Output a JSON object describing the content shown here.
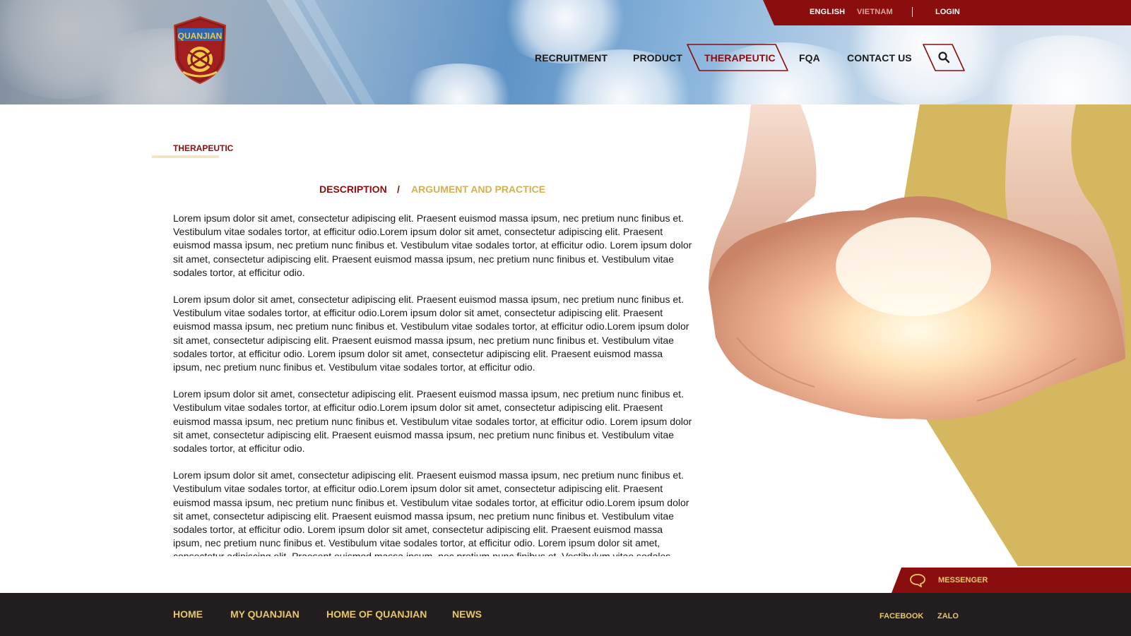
{
  "header": {
    "brand": "QUANJIAN",
    "languages": [
      {
        "label": "ENGLISH",
        "active": true
      },
      {
        "label": "VIETNAM",
        "active": false
      }
    ],
    "login_label": "LOGIN",
    "nav": [
      {
        "label": "RECRUITMENT",
        "active": false
      },
      {
        "label": "PRODUCT",
        "active": false
      },
      {
        "label": "THERAPEUTIC",
        "active": true
      },
      {
        "label": "FQA",
        "active": false
      },
      {
        "label": "CONTACT US",
        "active": false
      }
    ],
    "search_icon": "search-icon"
  },
  "breadcrumb": "THERAPEUTIC",
  "tabs": {
    "description": "DESCRIPTION",
    "separator": "/",
    "argument": "ARGUMENT AND PRACTICE"
  },
  "article": {
    "paragraphs": [
      "Lorem ipsum dolor sit amet, consectetur adipiscing elit. Praesent euismod massa ipsum, nec pretium nunc finibus et. Vestibulum vitae sodales tortor, at efficitur odio.Lorem ipsum dolor sit amet, consectetur adipiscing elit. Praesent euismod massa ipsum, nec pretium nunc finibus et. Vestibulum vitae sodales tortor, at efficitur odio. Lorem ipsum dolor sit amet, consectetur adipiscing elit. Praesent euismod massa ipsum, nec pretium nunc finibus et. Vestibulum vitae sodales tortor, at efficitur odio.",
      "Lorem ipsum dolor sit amet, consectetur adipiscing elit. Praesent euismod massa ipsum, nec pretium nunc finibus et. Vestibulum vitae sodales tortor, at efficitur odio.Lorem ipsum dolor sit amet, consectetur adipiscing elit. Praesent euismod massa ipsum, nec pretium nunc finibus et. Vestibulum vitae sodales tortor, at efficitur odio.Lorem ipsum dolor sit amet, consectetur adipiscing elit. Praesent euismod massa ipsum, nec pretium nunc finibus et. Vestibulum vitae sodales tortor, at efficitur odio. Lorem ipsum dolor sit amet, consectetur adipiscing elit. Praesent euismod massa ipsum, nec pretium nunc finibus et. Vestibulum vitae sodales tortor, at efficitur odio.",
      "Lorem ipsum dolor sit amet, consectetur adipiscing elit. Praesent euismod massa ipsum, nec pretium nunc finibus et. Vestibulum vitae sodales tortor, at efficitur odio.Lorem ipsum dolor sit amet, consectetur adipiscing elit. Praesent euismod massa ipsum, nec pretium nunc finibus et. Vestibulum vitae sodales tortor, at efficitur odio. Lorem ipsum dolor sit amet, consectetur adipiscing elit. Praesent euismod massa ipsum, nec pretium nunc finibus et. Vestibulum vitae sodales tortor, at efficitur odio.",
      "Lorem ipsum dolor sit amet, consectetur adipiscing elit. Praesent euismod massa ipsum, nec pretium nunc finibus et. Vestibulum vitae sodales tortor, at efficitur odio.Lorem ipsum dolor sit amet, consectetur adipiscing elit. Praesent euismod massa ipsum, nec pretium nunc finibus et. Vestibulum vitae sodales tortor, at efficitur odio.Lorem ipsum dolor sit amet, consectetur adipiscing elit. Praesent euismod massa ipsum, nec pretium nunc finibus et. Vestibulum vitae sodales tortor, at efficitur odio. Lorem ipsum dolor sit amet, consectetur adipiscing elit. Praesent euismod massa ipsum, nec pretium nunc finibus et. Vestibulum vitae sodales tortor, at efficitur odio. Lorem ipsum dolor sit amet, consectetur adipiscing elit. Praesent euismod massa ipsum, nec pretium nunc finibus et. Vestibulum vitae sodales"
    ]
  },
  "messenger": {
    "label": "MESSENGER",
    "icon": "chat-bubble-icon"
  },
  "footer": {
    "links": [
      "HOME",
      "MY QUANJIAN",
      "HOME OF QUANJIAN",
      "NEWS"
    ],
    "social": [
      "FACEBOOK",
      "ZALO"
    ]
  },
  "colors": {
    "brand_red": "#8b0e0e",
    "gold": "#d4b75e",
    "footer_bg": "#221e1f",
    "footer_text": "#e7c667"
  }
}
